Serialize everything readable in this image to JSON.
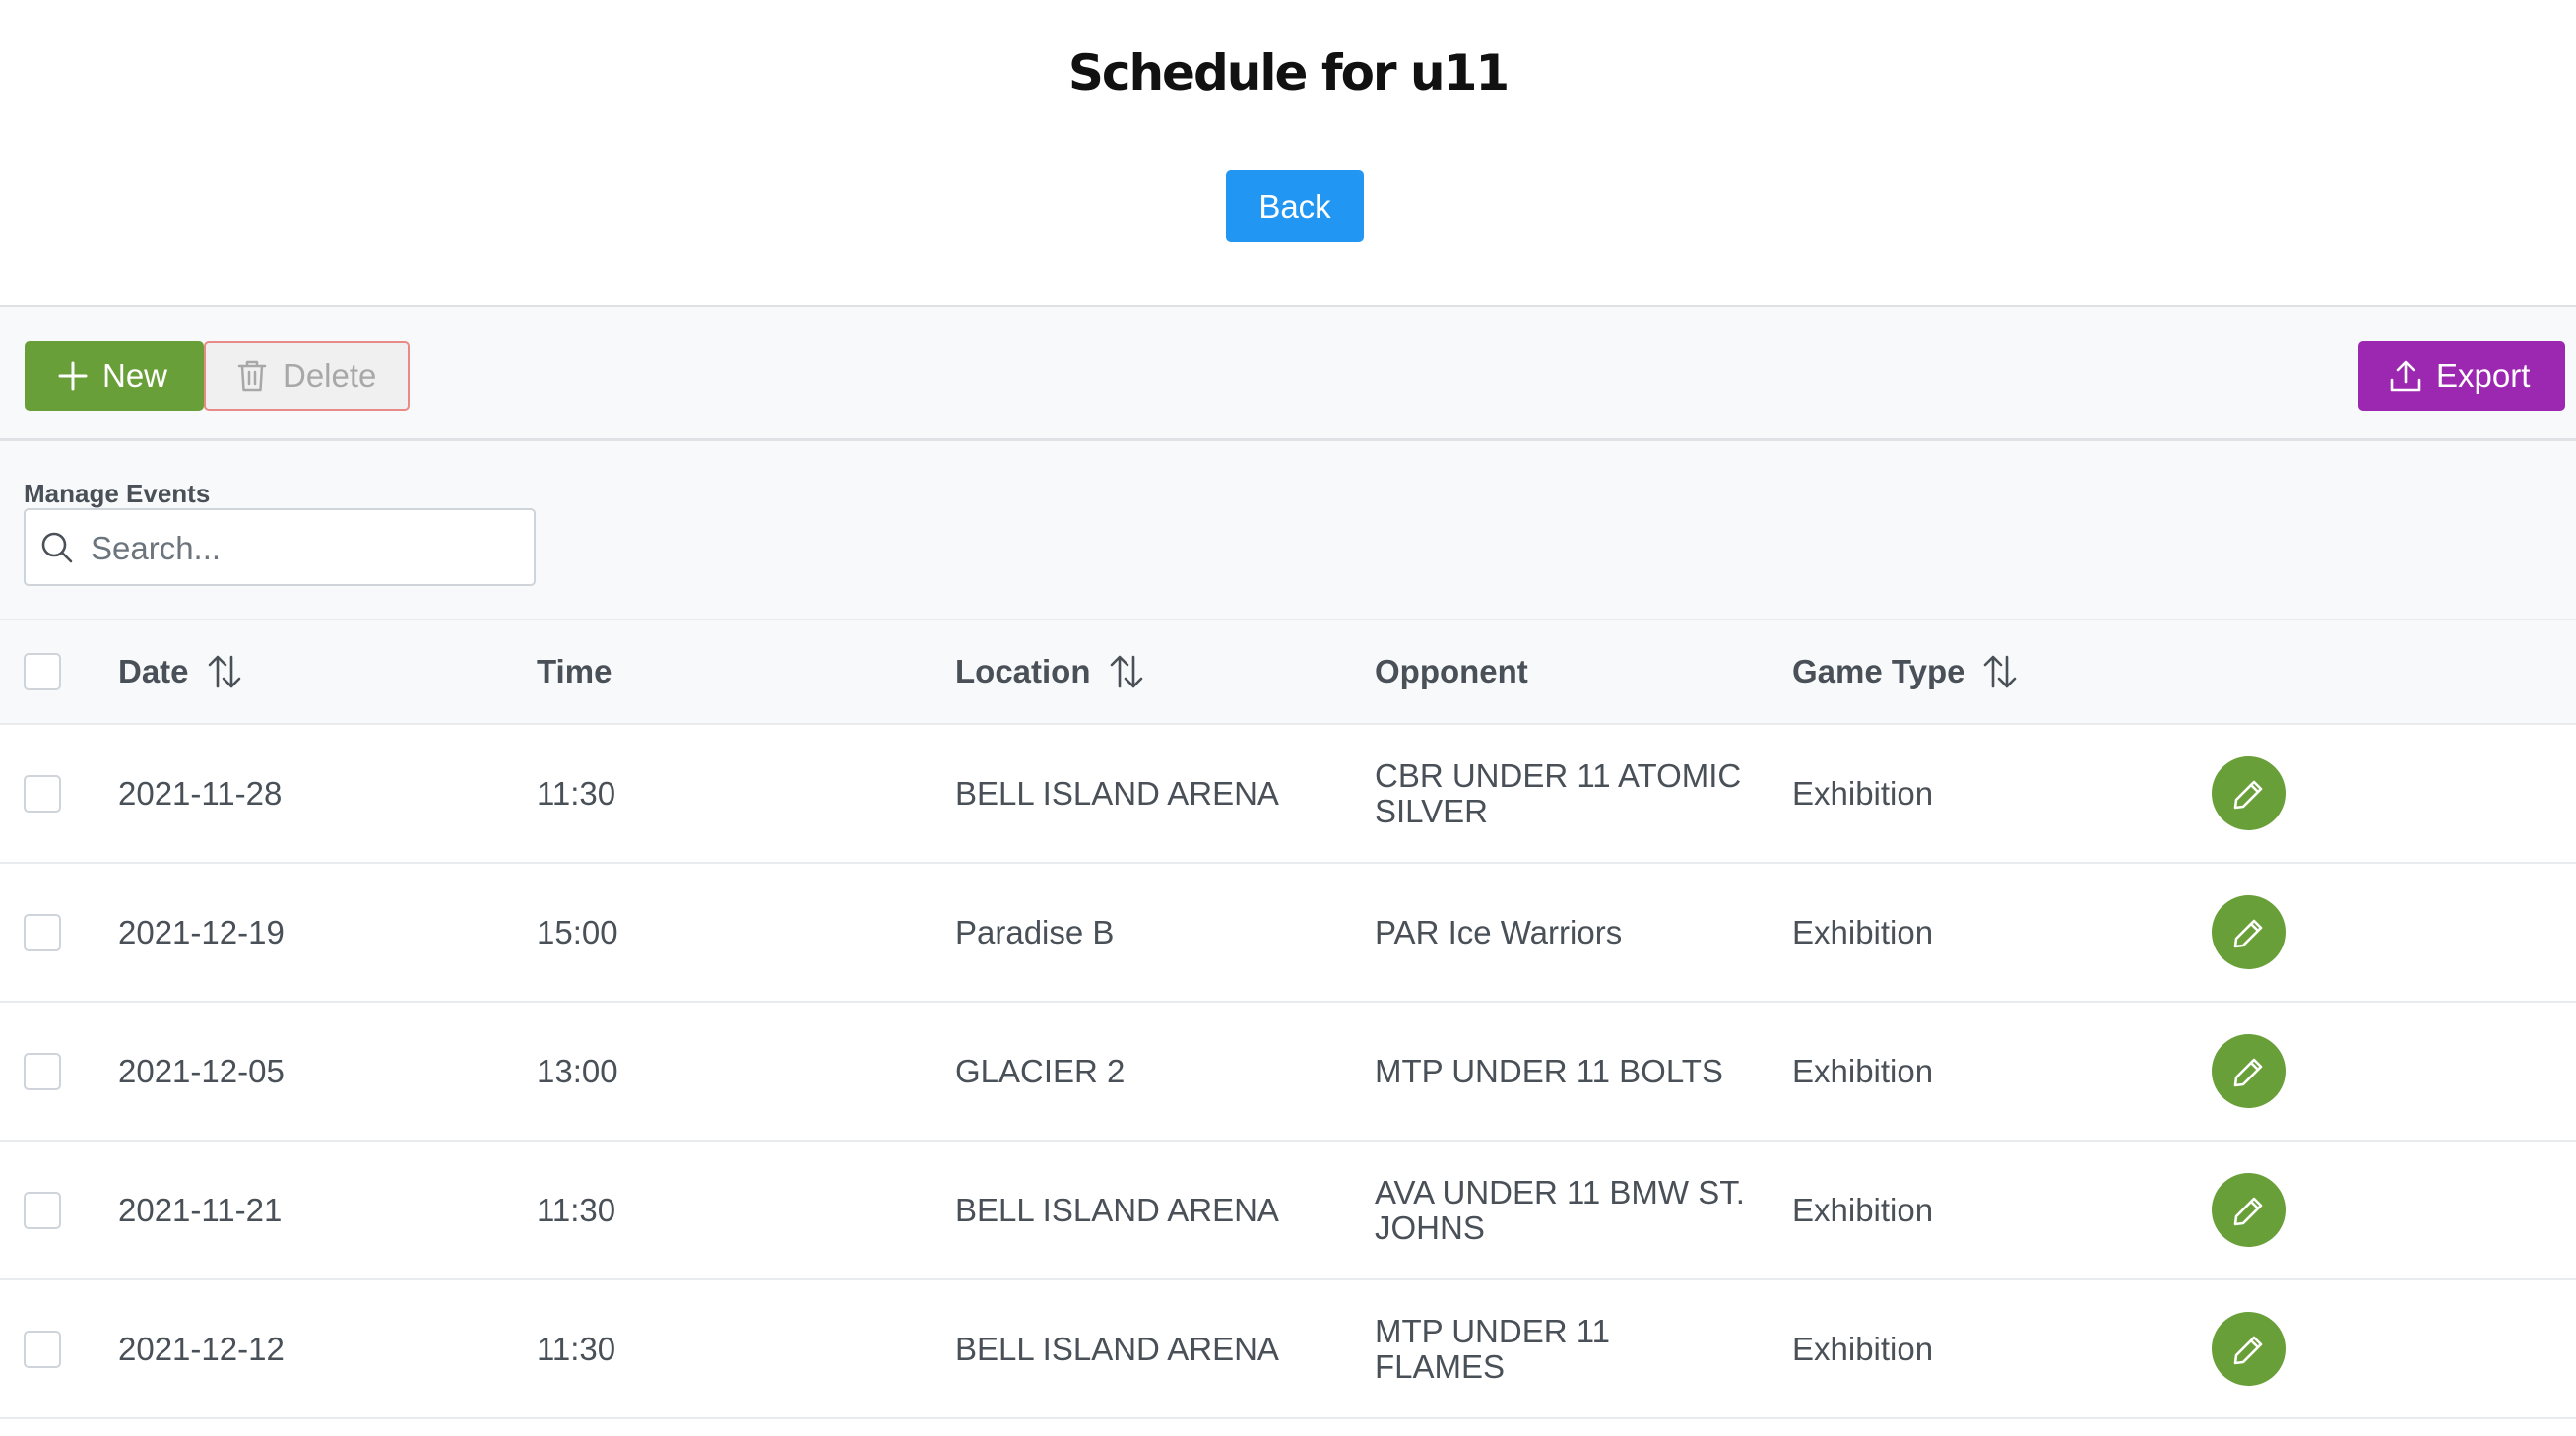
{
  "page_title": "Schedule for u11",
  "back_label": "Back",
  "toolbar": {
    "new_label": "New",
    "delete_label": "Delete",
    "export_label": "Export"
  },
  "manage": {
    "label": "Manage Events",
    "search_placeholder": "Search..."
  },
  "table": {
    "columns": {
      "date": "Date",
      "time": "Time",
      "location": "Location",
      "opponent": "Opponent",
      "game_type": "Game Type"
    },
    "rows": [
      {
        "date": "2021-11-28",
        "time": "11:30",
        "location": "BELL ISLAND ARENA",
        "opponent": "CBR UNDER 11 ATOMIC SILVER",
        "game_type": "Exhibition"
      },
      {
        "date": "2021-12-19",
        "time": "15:00",
        "location": "Paradise B",
        "opponent": "PAR Ice Warriors",
        "game_type": "Exhibition"
      },
      {
        "date": "2021-12-05",
        "time": "13:00",
        "location": "GLACIER 2",
        "opponent": "MTP UNDER 11 BOLTS",
        "game_type": "Exhibition"
      },
      {
        "date": "2021-11-21",
        "time": "11:30",
        "location": "BELL ISLAND ARENA",
        "opponent": "AVA UNDER 11 BMW ST. JOHNS",
        "game_type": "Exhibition"
      },
      {
        "date": "2021-12-12",
        "time": "11:30",
        "location": "BELL ISLAND ARENA",
        "opponent": "MTP UNDER 11 FLAMES",
        "game_type": "Exhibition"
      }
    ]
  },
  "colors": {
    "primary": "#2196f3",
    "success": "#689f38",
    "danger_border": "#e88b86",
    "help": "#9c27b0"
  },
  "icons": {
    "new": "plus-icon",
    "delete": "trash-icon",
    "export": "upload-icon",
    "search": "search-icon",
    "sort": "sort-icon",
    "edit": "pencil-icon"
  }
}
